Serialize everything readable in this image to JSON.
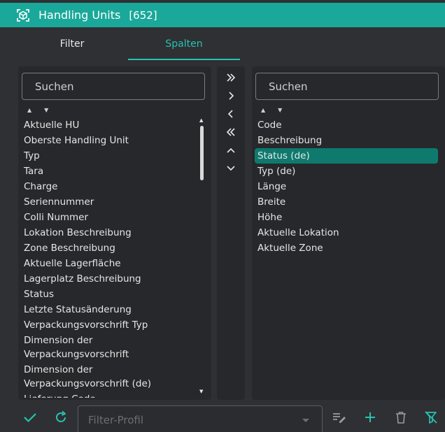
{
  "window": {
    "title": "Handling Units",
    "count": "[652]"
  },
  "tabs": [
    {
      "label": "Filter",
      "active": false
    },
    {
      "label": "Spalten",
      "active": true
    }
  ],
  "left_panel": {
    "search_placeholder": "Suchen",
    "items": [
      "Aktuelle HU",
      "Oberste Handling Unit",
      "Typ",
      "Tara",
      "Charge",
      "Seriennummer",
      "Colli Nummer",
      "Lokation Beschreibung",
      "Zone Beschreibung",
      "Aktuelle Lagerfläche",
      "Lagerplatz Beschreibung",
      "Status",
      "Letzte Statusänderung",
      "Verpackungsvorschrift Typ",
      "Dimension der Verpackungsvorschrift",
      "Dimension der Verpackungsvorschrift (de)",
      "Lieferung Code"
    ]
  },
  "middle_controls": [
    "move-all-right",
    "move-right",
    "move-left",
    "move-all-left",
    "move-up",
    "move-down"
  ],
  "right_panel": {
    "search_placeholder": "Suchen",
    "items": [
      "Code",
      "Beschreibung",
      "Status (de)",
      "Typ (de)",
      "Länge",
      "Breite",
      "Höhe",
      "Aktuelle Lokation",
      "Aktuelle Zone"
    ],
    "selected_index": 2
  },
  "bottom": {
    "profile_placeholder": "Filter-Profil"
  },
  "colors": {
    "accent": "#1aa89a",
    "tab_active": "#27c2b2",
    "selected_row": "#0e7a6e"
  }
}
